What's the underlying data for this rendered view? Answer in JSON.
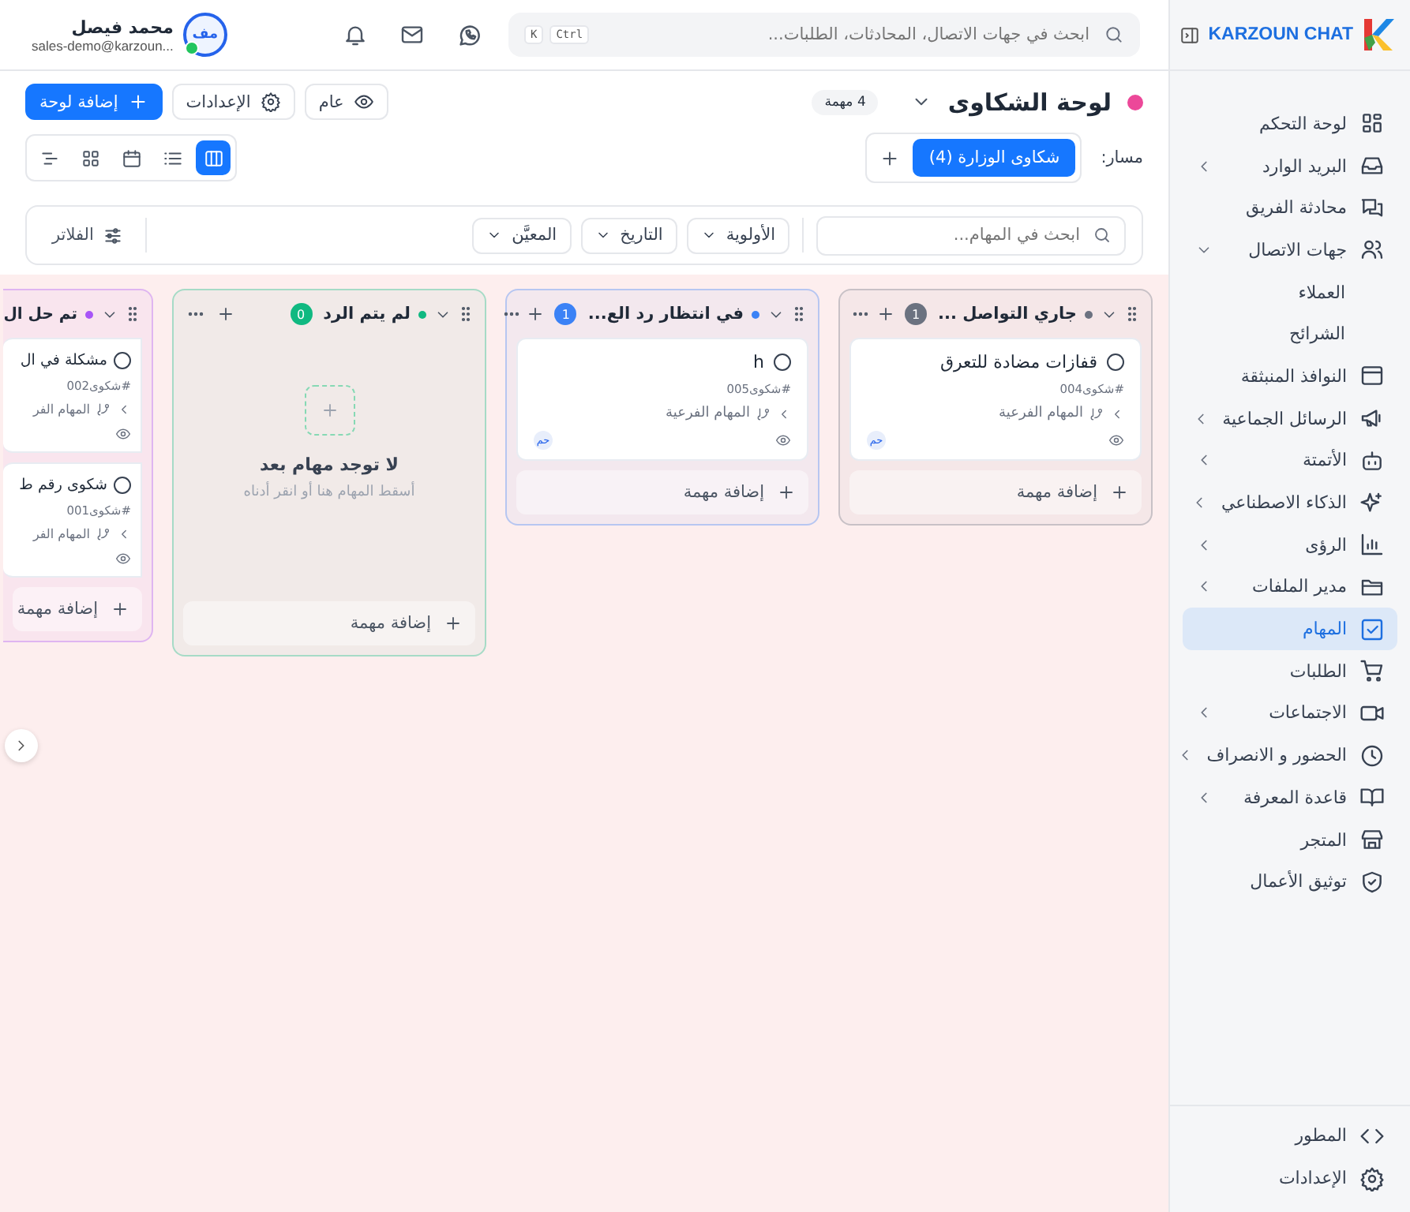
{
  "sidebar": {
    "brand": "KARZOUN CHAT",
    "items": [
      {
        "label": "لوحة التحكم",
        "submenu": false,
        "expanded": false,
        "selected": false
      },
      {
        "label": "البريد الوارد",
        "submenu": true,
        "expanded": false,
        "selected": false
      },
      {
        "label": "محادثة الفريق",
        "submenu": false,
        "expanded": false,
        "selected": false
      },
      {
        "label": "جهات الاتصال",
        "submenu": true,
        "expanded": true,
        "selected": false,
        "children": [
          {
            "label": "العملاء",
            "selected": false
          },
          {
            "label": "الشرائح",
            "selected": false
          }
        ]
      },
      {
        "label": "النوافذ المنبثقة",
        "submenu": false,
        "expanded": false,
        "selected": false
      },
      {
        "label": "الرسائل الجماعية",
        "submenu": true,
        "expanded": false,
        "selected": false
      },
      {
        "label": "الأتمتة",
        "submenu": true,
        "expanded": false,
        "selected": false
      },
      {
        "label": "الذكاء الاصطناعي",
        "submenu": true,
        "expanded": false,
        "selected": false
      },
      {
        "label": "الرؤى",
        "submenu": true,
        "expanded": false,
        "selected": false
      },
      {
        "label": "مدير الملفات",
        "submenu": true,
        "expanded": false,
        "selected": false
      },
      {
        "label": "المهام",
        "submenu": false,
        "expanded": false,
        "selected": true
      },
      {
        "label": "الطلبات",
        "submenu": false,
        "expanded": false,
        "selected": false
      },
      {
        "label": "الاجتماعات",
        "submenu": true,
        "expanded": false,
        "selected": false
      },
      {
        "label": "الحضور و الانصراف",
        "submenu": true,
        "expanded": false,
        "selected": false
      },
      {
        "label": "قاعدة المعرفة",
        "submenu": true,
        "expanded": false,
        "selected": false
      },
      {
        "label": "المتجر",
        "submenu": false,
        "expanded": false,
        "selected": false
      },
      {
        "label": "توثيق الأعمال",
        "submenu": false,
        "expanded": false,
        "selected": false
      }
    ],
    "footer": [
      {
        "label": "المطور"
      },
      {
        "label": "الإعدادات"
      }
    ]
  },
  "topbar": {
    "search": {
      "placeholder": "ابحث في جهات الاتصال، المحادثات، الطلبات..."
    },
    "shortcut": [
      "Ctrl",
      "K"
    ],
    "user": {
      "initials": "مف",
      "online": true,
      "name": "محمد فيصل",
      "email": "sales-demo@karzoun..."
    }
  },
  "board": {
    "title": "لوحة الشكاوى",
    "color": "#ec4899",
    "count": "4 مهمة",
    "actions": [
      {
        "kind": "visibility",
        "label": "عام"
      },
      {
        "kind": "settings",
        "label": "الإعدادات"
      },
      {
        "kind": "primary",
        "label": "إضافة لوحة"
      }
    ],
    "pipeline_label": "مسار:",
    "pipelines": [
      {
        "label": "شكاوى الوزارة (4)",
        "selected": true
      }
    ],
    "views": [
      {
        "selected": true
      },
      {
        "selected": false
      },
      {
        "selected": false
      },
      {
        "selected": false
      },
      {
        "selected": false
      }
    ],
    "filters": {
      "search": {
        "placeholder": "ابحث في المهام..."
      },
      "dropdowns": [
        "الأولوية",
        "التاريخ",
        "المعيَّن"
      ],
      "button": "الفلاتر"
    }
  },
  "columns": [
    {
      "title": "جاري التواصل ...",
      "color": "#6b7280",
      "count": "1",
      "partial": false,
      "add_label": "إضافة مهمة",
      "tasks": [
        {
          "title": "قفازات مضادة للتعرق",
          "code": "#شكوى004",
          "subtasks": "المهام الفرعية",
          "assignee": "حم",
          "done": false
        }
      ]
    },
    {
      "title": "في انتظار رد الع...",
      "color": "#3b82f6",
      "count": "1",
      "partial": false,
      "add_label": "إضافة مهمة",
      "tasks": [
        {
          "title": "h",
          "code": "#شكوى005",
          "subtasks": "المهام الفرعية",
          "assignee": "حم",
          "done": false
        }
      ]
    },
    {
      "title": "لم يتم الرد",
      "color": "#10b981",
      "count": "0",
      "partial": false,
      "add_label": "إضافة مهمة",
      "empty": {
        "title": "لا توجد مهام بعد",
        "hint": "أسقط المهام هنا أو انقر أدناه"
      }
    },
    {
      "title": "تم حل ال",
      "color": "#a855f7",
      "partial": true,
      "add_label": "إضافة مهمة",
      "tasks": [
        {
          "title": "مشكلة في ال",
          "code": "#شكوى002",
          "subtasks": "المهام الفر",
          "done": false
        },
        {
          "title": "شكوى رقم ط",
          "code": "#شكوى001",
          "subtasks": "المهام الفر",
          "done": false
        }
      ]
    }
  ]
}
